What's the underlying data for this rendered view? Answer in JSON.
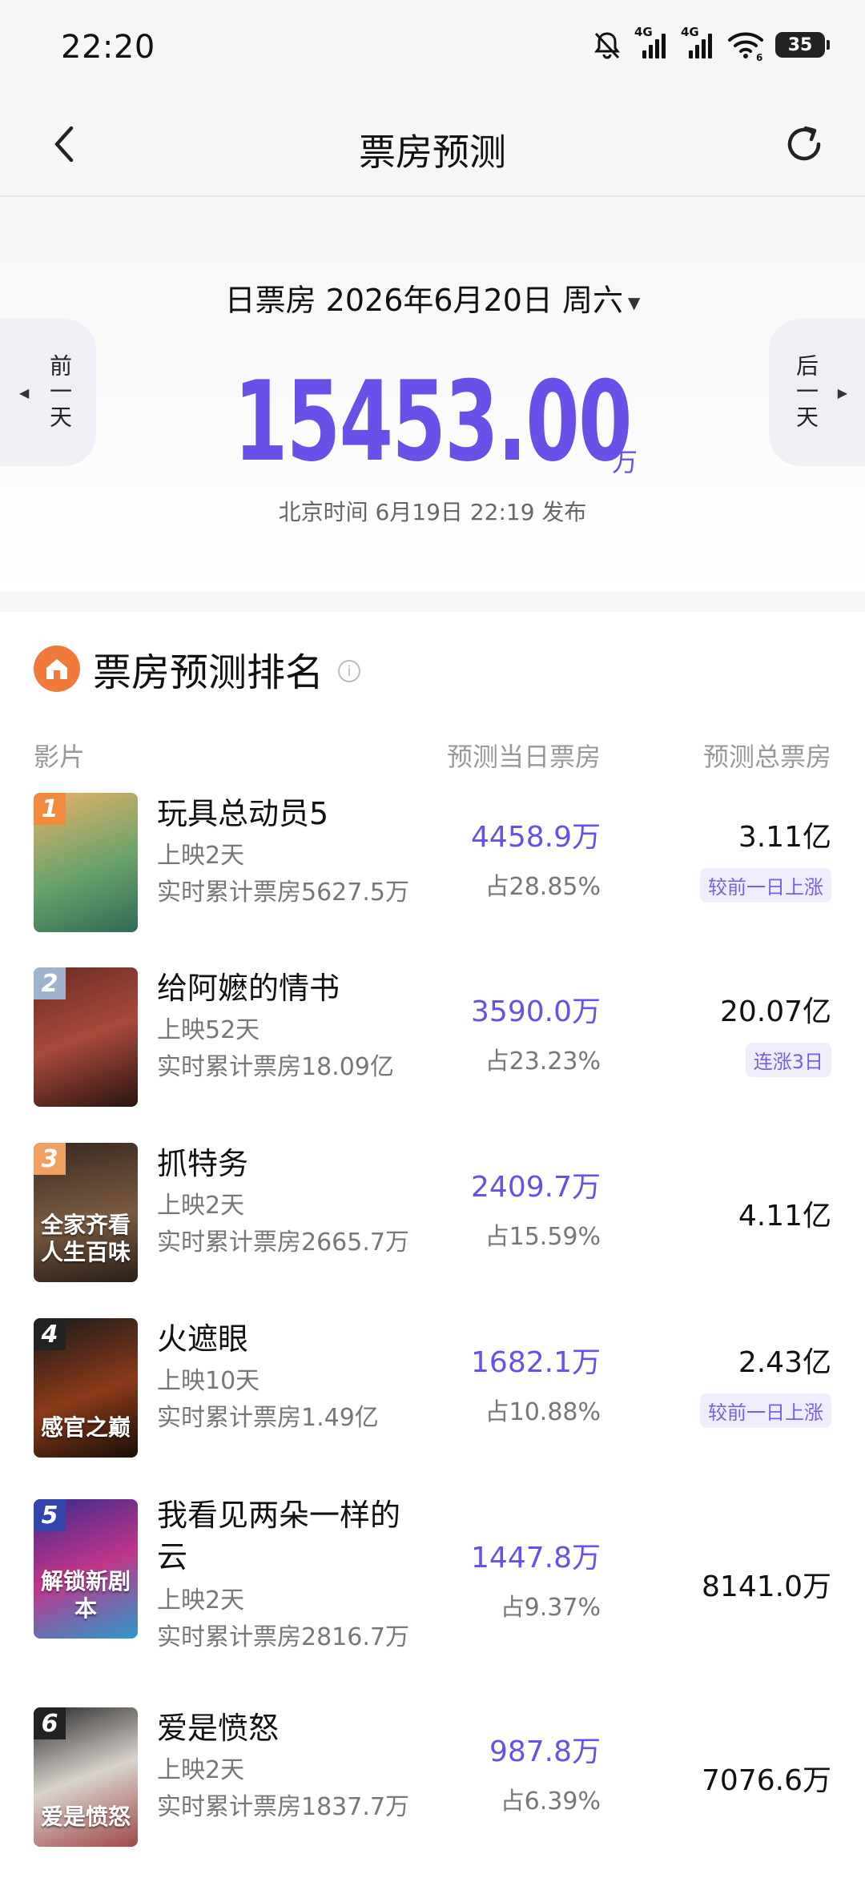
{
  "status_bar": {
    "time": "22:20",
    "net1": "4G",
    "net2": "4G",
    "wifi_sub": "6",
    "battery": "35"
  },
  "nav": {
    "title": "票房预测"
  },
  "hero": {
    "date_label": "日票房 2026年6月20日 周六",
    "caret": "▼",
    "prev_label": "前一天",
    "next_label": "后一天",
    "amount": "15453.00",
    "unit": "万",
    "publish_note": "北京时间 6月19日 22:19 发布"
  },
  "ranking": {
    "title": "票房预测排名",
    "col_film": "影片",
    "col_day": "预测当日票房",
    "col_total": "预测总票房",
    "rows": [
      {
        "rank": "1",
        "name": "玩具总动员5",
        "days": "上映2天",
        "cumulative": "实时累计票房5627.5万",
        "day_box": "4458.9万",
        "share": "占28.85%",
        "total": "3.11亿",
        "tag": "较前一日上涨",
        "poster_text": "",
        "rank_color": "#f08a3c",
        "poster_bg": "linear-gradient(160deg,#e7b06a,#6aa36a 55%,#2f6b55)"
      },
      {
        "rank": "2",
        "name": "给阿嬷的情书",
        "days": "上映52天",
        "cumulative": "实时累计票房18.09亿",
        "day_box": "3590.0万",
        "share": "占23.23%",
        "total": "20.07亿",
        "tag": "连涨3日",
        "poster_text": "",
        "rank_color": "#9fb3cf",
        "poster_bg": "linear-gradient(160deg,#6b2b22,#a84a3a 50%,#2a1410)"
      },
      {
        "rank": "3",
        "name": "抓特务",
        "days": "上映2天",
        "cumulative": "实时累计票房2665.7万",
        "day_box": "2409.7万",
        "share": "占15.59%",
        "total": "4.11亿",
        "tag": "",
        "poster_text": "全家齐看 人生百味",
        "rank_color": "#f0a060",
        "poster_bg": "linear-gradient(170deg,#3a2a20,#7a5a40 55%,#2a1f18)"
      },
      {
        "rank": "4",
        "name": "火遮眼",
        "days": "上映10天",
        "cumulative": "实时累计票房1.49亿",
        "day_box": "1682.1万",
        "share": "占10.88%",
        "total": "2.43亿",
        "tag": "较前一日上涨",
        "poster_text": "感官之巅",
        "rank_color": "#222222",
        "poster_bg": "linear-gradient(160deg,#1a1a1a,#8a3a18 55%,#1a0e08)"
      },
      {
        "rank": "5",
        "name": "我看见两朵一样的云",
        "days": "上映2天",
        "cumulative": "实时累计票房2816.7万",
        "day_box": "1447.8万",
        "share": "占9.37%",
        "total": "8141.0万",
        "tag": "",
        "poster_text": "解锁新剧本",
        "rank_color": "#3344aa",
        "poster_bg": "linear-gradient(160deg,#3b2a8a,#c0358a 50%,#2a9acb)"
      },
      {
        "rank": "6",
        "name": "爱是愤怒",
        "days": "上映2天",
        "cumulative": "实时累计票房1837.7万",
        "day_box": "987.8万",
        "share": "占6.39%",
        "total": "7076.6万",
        "tag": "",
        "poster_text": "爱是愤怒",
        "rank_color": "#222222",
        "poster_bg": "linear-gradient(160deg,#2a2a2a,#d9d3cc 50%,#a04848)"
      }
    ]
  }
}
